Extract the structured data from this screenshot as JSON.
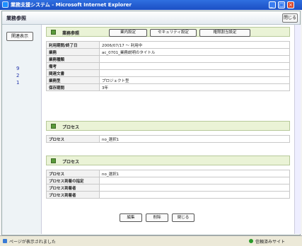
{
  "window": {
    "title": "業務支援システム - Microsoft Internet Explorer"
  },
  "page": {
    "title": "業務参照",
    "help_label": "閉じる"
  },
  "leftpane": {
    "button_label": "関連表示",
    "links": [
      "9",
      "2",
      "1"
    ]
  },
  "section1": {
    "label": "業務参照",
    "buttons": [
      "業内設定",
      "セキュリティ設定",
      "権限割当設定"
    ],
    "rows": [
      {
        "label": "利用期間/終了日",
        "value": "2006/07/17 ～ 利用中"
      },
      {
        "label": "業務",
        "value": "ac_0701_業務説明のタイトル"
      },
      {
        "label": "業務種類",
        "value": ""
      },
      {
        "label": "備考",
        "value": ""
      },
      {
        "label": "関連文書",
        "value": ""
      },
      {
        "label": "業務型",
        "value": "プロジェクト型"
      },
      {
        "label": "保存期間",
        "value": "3年"
      }
    ]
  },
  "section2": {
    "label": "プロセス",
    "rows": [
      {
        "label": "プロセス",
        "value": "no_選択1"
      }
    ]
  },
  "section3": {
    "label": "プロセス",
    "rows": [
      {
        "label": "プロセス",
        "value": "no_選択1"
      },
      {
        "label": "プロセス到着の指定",
        "value": ""
      },
      {
        "label": "プロセス到着者",
        "value": ""
      },
      {
        "label": "プロセス到着者",
        "value": ""
      }
    ]
  },
  "actions": {
    "buttons": [
      "編集",
      "削除",
      "閉じる"
    ]
  },
  "statusbar": {
    "text": "ページが表示されました",
    "zone": "信頼済みサイト"
  }
}
